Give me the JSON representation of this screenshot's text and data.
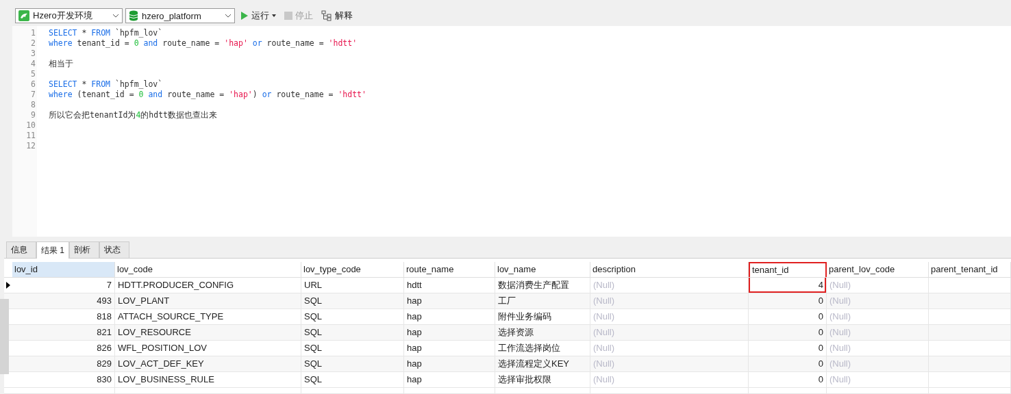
{
  "toolbar": {
    "connection": "Hzero开发环境",
    "database": "hzero_platform",
    "run_label": "运行",
    "stop_label": "停止",
    "stop_disabled": true,
    "explain_label": "解释"
  },
  "editor": {
    "lines": [
      {
        "number": "1",
        "tokens": [
          {
            "kind": "keyword",
            "text": "SELECT"
          },
          {
            "kind": "plain",
            "text": " * "
          },
          {
            "kind": "keyword",
            "text": "FROM"
          },
          {
            "kind": "plain",
            "text": " `hpfm_lov`"
          }
        ]
      },
      {
        "number": "2",
        "tokens": [
          {
            "kind": "keyword",
            "text": "where"
          },
          {
            "kind": "plain",
            "text": " tenant_id = "
          },
          {
            "kind": "number",
            "text": "0"
          },
          {
            "kind": "keyword",
            "text": " and"
          },
          {
            "kind": "plain",
            "text": " route_name = "
          },
          {
            "kind": "string",
            "text": "'hap'"
          },
          {
            "kind": "keyword",
            "text": " or"
          },
          {
            "kind": "plain",
            "text": " route_name = "
          },
          {
            "kind": "string",
            "text": "'hdtt'"
          }
        ]
      },
      {
        "number": "3"
      },
      {
        "number": "4",
        "tokens": [
          {
            "kind": "plain",
            "text": "相当于"
          }
        ]
      },
      {
        "number": "5"
      },
      {
        "number": "6",
        "tokens": [
          {
            "kind": "keyword",
            "text": "SELECT"
          },
          {
            "kind": "plain",
            "text": " * "
          },
          {
            "kind": "keyword",
            "text": "FROM"
          },
          {
            "kind": "plain",
            "text": " `hpfm_lov`"
          }
        ]
      },
      {
        "number": "7",
        "tokens": [
          {
            "kind": "keyword",
            "text": "where"
          },
          {
            "kind": "plain",
            "text": " (tenant_id = "
          },
          {
            "kind": "number",
            "text": "0"
          },
          {
            "kind": "keyword",
            "text": " and"
          },
          {
            "kind": "plain",
            "text": " route_name = "
          },
          {
            "kind": "string",
            "text": "'hap'"
          },
          {
            "kind": "plain",
            "text": ")"
          },
          {
            "kind": "keyword",
            "text": " or"
          },
          {
            "kind": "plain",
            "text": " route_name = "
          },
          {
            "kind": "string",
            "text": "'hdtt'"
          }
        ]
      },
      {
        "number": "8"
      },
      {
        "number": "9",
        "tokens": [
          {
            "kind": "plain",
            "text": "所以它会把tenantId为"
          },
          {
            "kind": "number",
            "text": "4"
          },
          {
            "kind": "plain",
            "text": "的hdtt数据也查出来"
          }
        ]
      },
      {
        "number": "10"
      },
      {
        "number": "11"
      },
      {
        "number": "12"
      }
    ]
  },
  "result_tabs": [
    {
      "label": "信息",
      "selected": false
    },
    {
      "label": "结果 1",
      "selected": true
    },
    {
      "label": "剖析",
      "selected": false
    },
    {
      "label": "状态",
      "selected": false
    }
  ],
  "table": {
    "columns": [
      {
        "label": "lov_id",
        "kind": "numeric",
        "selected": true,
        "highlighted": false
      },
      {
        "label": "lov_code",
        "kind": "text",
        "selected": false,
        "highlighted": false
      },
      {
        "label": "lov_type_code",
        "kind": "text",
        "selected": false,
        "highlighted": false
      },
      {
        "label": "route_name",
        "kind": "text",
        "selected": false,
        "highlighted": false
      },
      {
        "label": "lov_name",
        "kind": "text",
        "selected": false,
        "highlighted": false
      },
      {
        "label": "description",
        "kind": "text",
        "selected": false,
        "highlighted": false
      },
      {
        "label": "tenant_id",
        "kind": "numeric",
        "selected": false,
        "highlighted": true
      },
      {
        "label": "parent_lov_code",
        "kind": "text",
        "selected": false,
        "highlighted": false
      },
      {
        "label": "parent_tenant_id",
        "kind": "text",
        "selected": false,
        "highlighted": false
      }
    ],
    "rows": [
      {
        "selected": true,
        "cells": [
          {
            "text": "7"
          },
          {
            "text": "HDTT.PRODUCER_CONFIG"
          },
          {
            "text": "URL"
          },
          {
            "text": "hdtt"
          },
          {
            "text": "数据消费生产配置"
          },
          {
            "text": "(Null)",
            "null": true
          },
          {
            "text": "4"
          },
          {
            "text": "(Null)",
            "null": true
          }
        ]
      },
      {
        "selected": false,
        "cells": [
          {
            "text": "493"
          },
          {
            "text": "LOV_PLANT"
          },
          {
            "text": "SQL"
          },
          {
            "text": "hap"
          },
          {
            "text": "工厂"
          },
          {
            "text": "(Null)",
            "null": true
          },
          {
            "text": "0"
          },
          {
            "text": "(Null)",
            "null": true
          }
        ]
      },
      {
        "selected": false,
        "cells": [
          {
            "text": "818"
          },
          {
            "text": "ATTACH_SOURCE_TYPE"
          },
          {
            "text": "SQL"
          },
          {
            "text": "hap"
          },
          {
            "text": "附件业务编码"
          },
          {
            "text": "(Null)",
            "null": true
          },
          {
            "text": "0"
          },
          {
            "text": "(Null)",
            "null": true
          }
        ]
      },
      {
        "selected": false,
        "cells": [
          {
            "text": "821"
          },
          {
            "text": "LOV_RESOURCE"
          },
          {
            "text": "SQL"
          },
          {
            "text": "hap"
          },
          {
            "text": "选择资源"
          },
          {
            "text": "(Null)",
            "null": true
          },
          {
            "text": "0"
          },
          {
            "text": "(Null)",
            "null": true
          }
        ]
      },
      {
        "selected": false,
        "cells": [
          {
            "text": "826"
          },
          {
            "text": "WFL_POSITION_LOV"
          },
          {
            "text": "SQL"
          },
          {
            "text": "hap"
          },
          {
            "text": "工作流选择岗位"
          },
          {
            "text": "(Null)",
            "null": true
          },
          {
            "text": "0"
          },
          {
            "text": "(Null)",
            "null": true
          }
        ]
      },
      {
        "selected": false,
        "cells": [
          {
            "text": "829"
          },
          {
            "text": "LOV_ACT_DEF_KEY"
          },
          {
            "text": "SQL"
          },
          {
            "text": "hap"
          },
          {
            "text": "选择流程定义KEY"
          },
          {
            "text": "(Null)",
            "null": true
          },
          {
            "text": "0"
          },
          {
            "text": "(Null)",
            "null": true
          }
        ]
      },
      {
        "selected": false,
        "cells": [
          {
            "text": "830"
          },
          {
            "text": "LOV_BUSINESS_RULE"
          },
          {
            "text": "SQL"
          },
          {
            "text": "hap"
          },
          {
            "text": "选择审批权限"
          },
          {
            "text": "(Null)",
            "null": true
          },
          {
            "text": "0"
          },
          {
            "text": "(Null)",
            "null": true
          }
        ]
      }
    ]
  }
}
